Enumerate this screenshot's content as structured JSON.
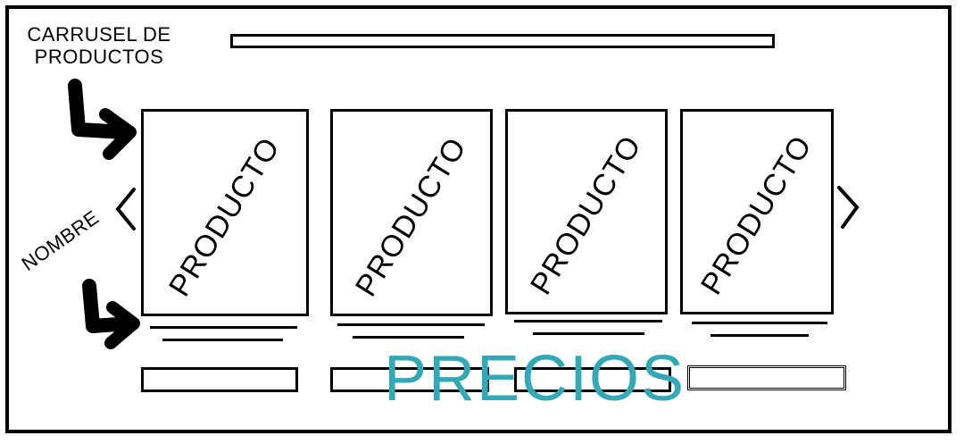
{
  "annotations": {
    "carrusel": "CARRUSEL DE PRODUCTOS",
    "nombre": "NOMBRE",
    "precios": "PRECIOS"
  },
  "products": [
    {
      "label": "PRODUCTO"
    },
    {
      "label": "PRODUCTO"
    },
    {
      "label": "PRODUCTO"
    },
    {
      "label": "PRODUCTO"
    }
  ],
  "colors": {
    "precios_accent": "#33a9b8",
    "ink": "#000000"
  },
  "icons": {
    "prev": "chevron-left-icon",
    "next": "chevron-right-icon"
  }
}
